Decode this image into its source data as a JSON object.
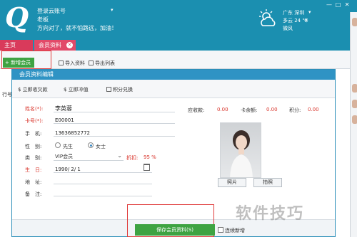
{
  "header": {
    "account_label": "登录云账号",
    "account_caret": "▾",
    "owner": "老板",
    "slogan": "方向对了，就不怕路远，加油！",
    "weather": {
      "city": "广东 深圳",
      "city_arrow": "▾",
      "temp": "多云 24 ℃",
      "temp_arrow": "▸",
      "wind": "微风",
      "icon": "cloud-sun-icon"
    },
    "window_controls": [
      "—",
      "□",
      "✕"
    ]
  },
  "tabs": [
    {
      "label": "主页",
      "active": false
    },
    {
      "label": "会员资料",
      "active": true,
      "close": "✕"
    }
  ],
  "toolbar": {
    "add_label": "+ 新增会员",
    "import_label": "导入资料",
    "export_label": "导出列表"
  },
  "list": {
    "header_first": "行号"
  },
  "dialog": {
    "title": "会员资料编辑",
    "toolbar": {
      "recharge_debt": "$ 立即收欠款",
      "recharge": "$ 立即冲值",
      "points": "积分兑换"
    },
    "form": {
      "name_label": "姓名(*):",
      "name_value": "李英蓉",
      "card_label": "卡号(*):",
      "card_value": "E00001",
      "phone_label": "手　机:",
      "phone_value": "13636852772",
      "gender_label": "性　别:",
      "gender_male": "先生",
      "gender_female": "女士",
      "gender_selected": "女士",
      "type_label": "类　别:",
      "type_value": "VIP会员",
      "discount_label": "折扣:",
      "discount_value": "95 %",
      "birth_label": "生　日:",
      "birth_value": "1990/ 2/ 1",
      "address_label": "地　址:",
      "note_label": "备　注:"
    },
    "balances": {
      "receivable_label": "应收款:",
      "receivable_value": "0.00",
      "card_balance_label": "卡余额:",
      "card_balance_value": "0.00",
      "points_label": "积分:",
      "points_value": "0.00"
    },
    "photo_button": "照片",
    "shoot_button": "拍照",
    "save_button": "保存会员资料(S)",
    "continue_label": "连续新增"
  },
  "watermark": "软件技巧",
  "colors": {
    "brand_blue": "#1b8fb0",
    "tab_pink": "#e24a69",
    "accent_green": "#3ea342",
    "required_red": "#d9342b",
    "highlight_red": "#e03c3c"
  }
}
